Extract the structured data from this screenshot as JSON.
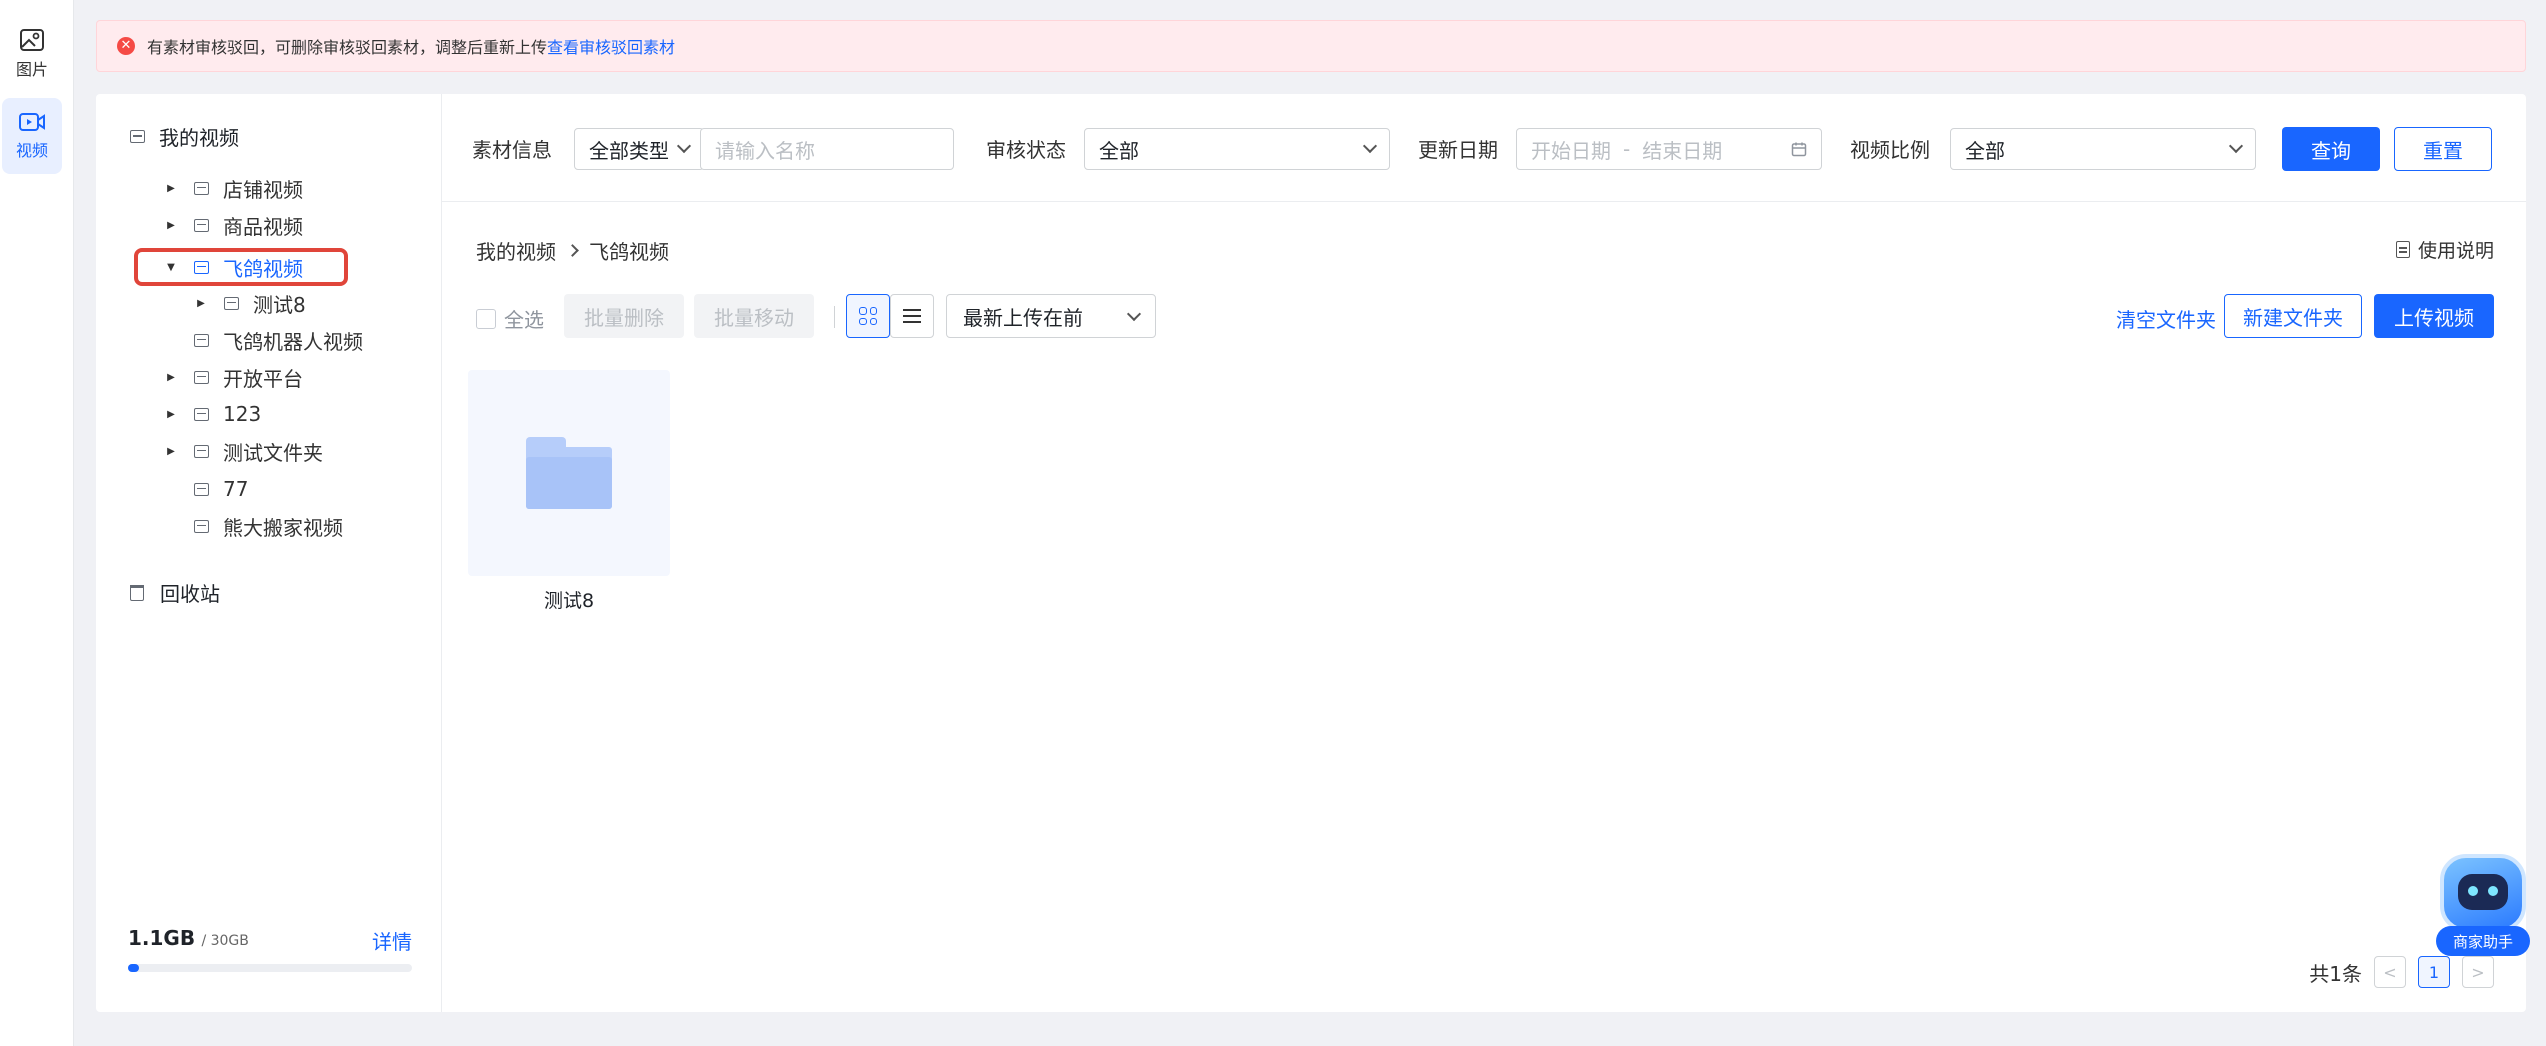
{
  "rail": {
    "items": [
      {
        "label": "图片",
        "icon": "image-icon"
      },
      {
        "label": "视频",
        "icon": "video-icon",
        "active": true
      }
    ]
  },
  "alert": {
    "message": "有素材审核驳回，可删除审核驳回素材，调整后重新上传",
    "link": "查看审核驳回素材"
  },
  "tree": {
    "root": "我的视频",
    "nodes": [
      {
        "label": "店铺视频",
        "expandable": true
      },
      {
        "label": "商品视频",
        "expandable": true
      },
      {
        "label": "飞鸽视频",
        "expanded": true,
        "selected": true
      },
      {
        "label": "测试8",
        "expandable": true,
        "child": true
      },
      {
        "label": "飞鸽机器人视频",
        "expandable": false
      },
      {
        "label": "开放平台",
        "expandable": true
      },
      {
        "label": "123",
        "expandable": true
      },
      {
        "label": "测试文件夹",
        "expandable": true
      },
      {
        "label": "77",
        "expandable": false
      },
      {
        "label": "熊大搬家视频",
        "expandable": false
      }
    ],
    "trash": "回收站"
  },
  "storage": {
    "used": "1.1GB",
    "total": "/ 30GB",
    "detail": "详情",
    "used_fraction": 0.037
  },
  "filters": {
    "material_label": "素材信息",
    "type_value": "全部类型",
    "name_placeholder": "请输入名称",
    "review_label": "审核状态",
    "review_value": "全部",
    "date_label": "更新日期",
    "start_placeholder": "开始日期",
    "date_sep": "-",
    "end_placeholder": "结束日期",
    "ratio_label": "视频比例",
    "ratio_value": "全部",
    "query_btn": "查询",
    "reset_btn": "重置"
  },
  "breadcrumb": {
    "root": "我的视频",
    "current": "飞鸽视频"
  },
  "manual": "使用说明",
  "toolbar": {
    "select_all": "全选",
    "batch_delete": "批量删除",
    "batch_move": "批量移动",
    "sort_value": "最新上传在前",
    "clear_folder": "清空文件夹",
    "new_folder": "新建文件夹",
    "upload": "上传视频"
  },
  "items": [
    {
      "name": "测试8",
      "type": "folder"
    }
  ],
  "pager": {
    "total": "共1条",
    "prev": "<",
    "current": "1",
    "next": ">"
  },
  "assistant": {
    "label": "商家助手"
  },
  "colors": {
    "accent": "#1966ff",
    "alert_bg": "#ffebee",
    "error": "#f54a45",
    "highlight": "#e0453a"
  }
}
